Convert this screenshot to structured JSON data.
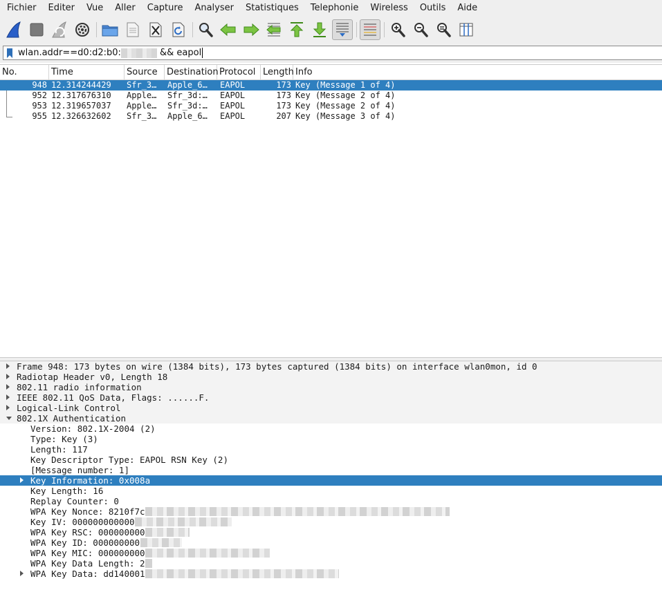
{
  "menu": [
    "Fichier",
    "Editer",
    "Vue",
    "Aller",
    "Capture",
    "Analyser",
    "Statistiques",
    "Telephonie",
    "Wireless",
    "Outils",
    "Aide"
  ],
  "filter": {
    "prefix": "wlan.addr==d0:d2:b0:",
    "suffix": " && eapol"
  },
  "columns": {
    "no": "No.",
    "time": "Time",
    "source": "Source",
    "destination": "Destination",
    "protocol": "Protocol",
    "length": "Length",
    "info": "Info"
  },
  "packets": [
    {
      "no": "948",
      "time": "12.314244429",
      "source": "Sfr_3…",
      "destination": "Apple_6…",
      "protocol": "EAPOL",
      "length": "173",
      "info": "Key (Message 1 of 4)",
      "selected": true
    },
    {
      "no": "952",
      "time": "12.317676310",
      "source": "Apple…",
      "destination": "Sfr_3d:…",
      "protocol": "EAPOL",
      "length": "173",
      "info": "Key (Message 2 of 4)"
    },
    {
      "no": "953",
      "time": "12.319657037",
      "source": "Apple…",
      "destination": "Sfr_3d:…",
      "protocol": "EAPOL",
      "length": "173",
      "info": "Key (Message 2 of 4)"
    },
    {
      "no": "955",
      "time": "12.326632602",
      "source": "Sfr_3…",
      "destination": "Apple_6…",
      "protocol": "EAPOL",
      "length": "207",
      "info": "Key (Message 3 of 4)"
    }
  ],
  "details": [
    {
      "text": "Frame 948: 173 bytes on wire (1384 bits), 173 bytes captured (1384 bits) on interface wlan0mon, id 0",
      "level": 0,
      "toggle": "collapsed"
    },
    {
      "text": "Radiotap Header v0, Length 18",
      "level": 0,
      "toggle": "collapsed"
    },
    {
      "text": "802.11 radio information",
      "level": 0,
      "toggle": "collapsed"
    },
    {
      "text": "IEEE 802.11 QoS Data, Flags: ......F.",
      "level": 0,
      "toggle": "collapsed"
    },
    {
      "text": "Logical-Link Control",
      "level": 0,
      "toggle": "collapsed"
    },
    {
      "text": "802.1X Authentication",
      "level": 0,
      "toggle": "expanded"
    },
    {
      "text": "Version: 802.1X-2004 (2)",
      "level": 1
    },
    {
      "text": "Type: Key (3)",
      "level": 1
    },
    {
      "text": "Length: 117",
      "level": 1
    },
    {
      "text": "Key Descriptor Type: EAPOL RSN Key (2)",
      "level": 1
    },
    {
      "text": "[Message number: 1]",
      "level": 1
    },
    {
      "text": "Key Information: 0x008a",
      "level": 1,
      "toggle": "collapsed",
      "selected": true
    },
    {
      "text": "Key Length: 16",
      "level": 1
    },
    {
      "text": "Replay Counter: 0",
      "level": 1
    },
    {
      "text": "WPA Key Nonce: 8210f7c",
      "level": 1,
      "redacted": true
    },
    {
      "text": "Key IV: 000000000000",
      "level": 1,
      "redacted": true
    },
    {
      "text": "WPA Key RSC: 000000000",
      "level": 1,
      "redacted": true
    },
    {
      "text": "WPA Key ID: 000000000",
      "level": 1,
      "redacted": true
    },
    {
      "text": "WPA Key MIC: 000000000",
      "level": 1,
      "redacted": true
    },
    {
      "text": "WPA Key Data Length: 2",
      "level": 1,
      "redacted": true
    },
    {
      "text": "WPA Key Data: dd140001",
      "level": 1,
      "toggle": "collapsed",
      "redacted": true
    }
  ],
  "colors": {
    "selection": "#2e7fbf",
    "chrome": "#efefef"
  }
}
